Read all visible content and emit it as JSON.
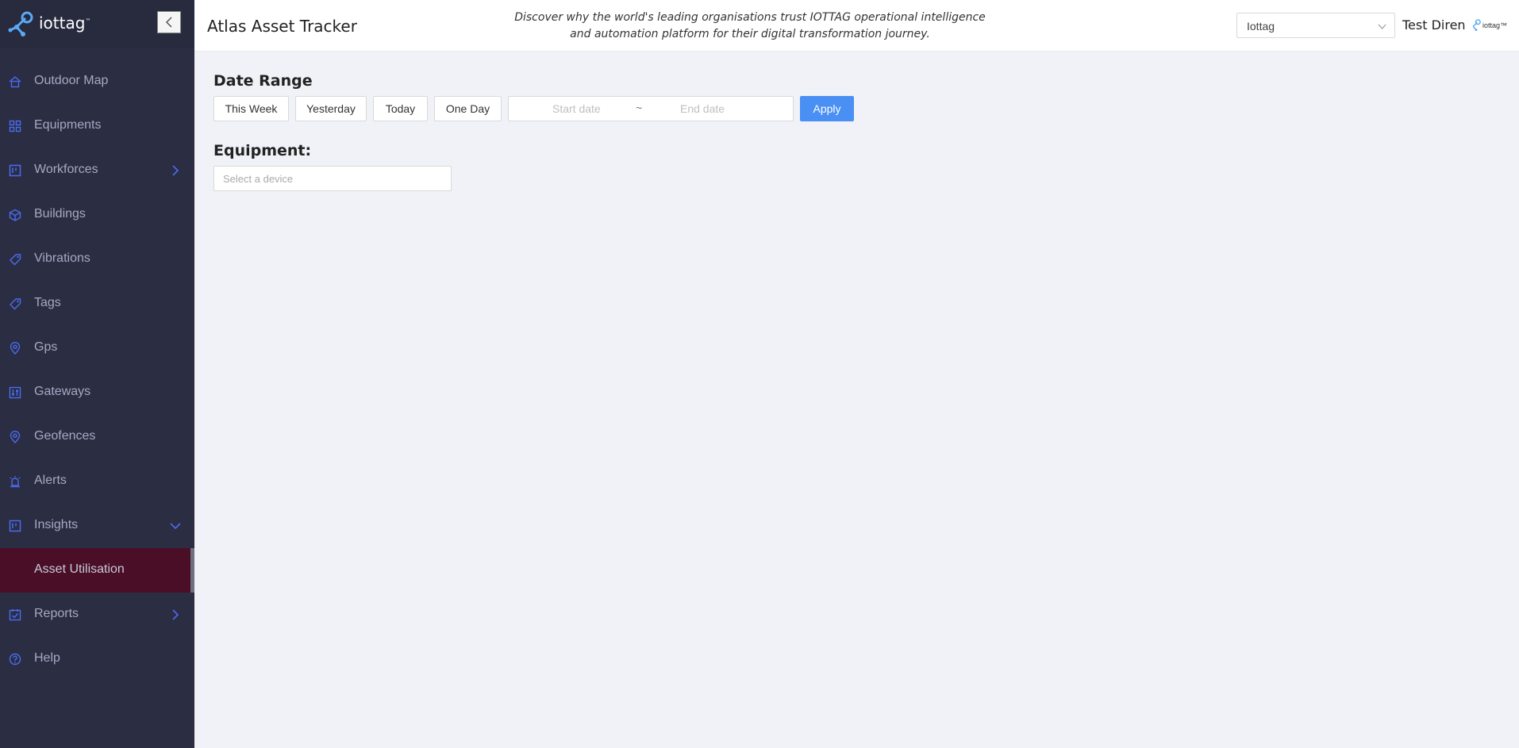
{
  "sidebar": {
    "brand": "iottag",
    "brand_tm": "™",
    "items": [
      {
        "label": "Outdoor Map",
        "icon": "home-icon"
      },
      {
        "label": "Equipments",
        "icon": "grid-icon"
      },
      {
        "label": "Workforces",
        "icon": "board-icon",
        "expand": "right"
      },
      {
        "label": "Buildings",
        "icon": "cube-icon"
      },
      {
        "label": "Vibrations",
        "icon": "tag-icon"
      },
      {
        "label": "Tags",
        "icon": "tag-icon"
      },
      {
        "label": "Gps",
        "icon": "pin-icon"
      },
      {
        "label": "Gateways",
        "icon": "sliders-icon"
      },
      {
        "label": "Geofences",
        "icon": "pin-icon"
      },
      {
        "label": "Alerts",
        "icon": "alarm-icon"
      },
      {
        "label": "Insights",
        "icon": "board-icon",
        "expand": "down"
      },
      {
        "label": "Asset Utilisation",
        "icon": "",
        "active": true
      },
      {
        "label": "Reports",
        "icon": "checklist-icon",
        "expand": "right"
      },
      {
        "label": "Help",
        "icon": "help-icon"
      }
    ]
  },
  "header": {
    "title": "Atlas Asset Tracker",
    "tagline": "Discover why the world's leading organisations trust IOTTAG operational intelligence and automation platform for their digital transformation journey.",
    "org_value": "Iottag",
    "user": "Test Diren",
    "mini_logo_text": "iottag™"
  },
  "main": {
    "date_range_title": "Date Range",
    "quick_buttons": [
      "This Week",
      "Yesterday",
      "Today",
      "One Day"
    ],
    "start_placeholder": "Start date",
    "range_separator": "~",
    "end_placeholder": "End date",
    "apply_label": "Apply",
    "equipment_title": "Equipment:",
    "device_placeholder": "Select a device"
  },
  "colors": {
    "sidebar_bg": "#2b2d43",
    "active_item_bg": "#4a0f27",
    "icon_blue": "#4a6cf0",
    "apply_bg": "#4a8ff4",
    "page_bg": "#f0f2f7"
  }
}
